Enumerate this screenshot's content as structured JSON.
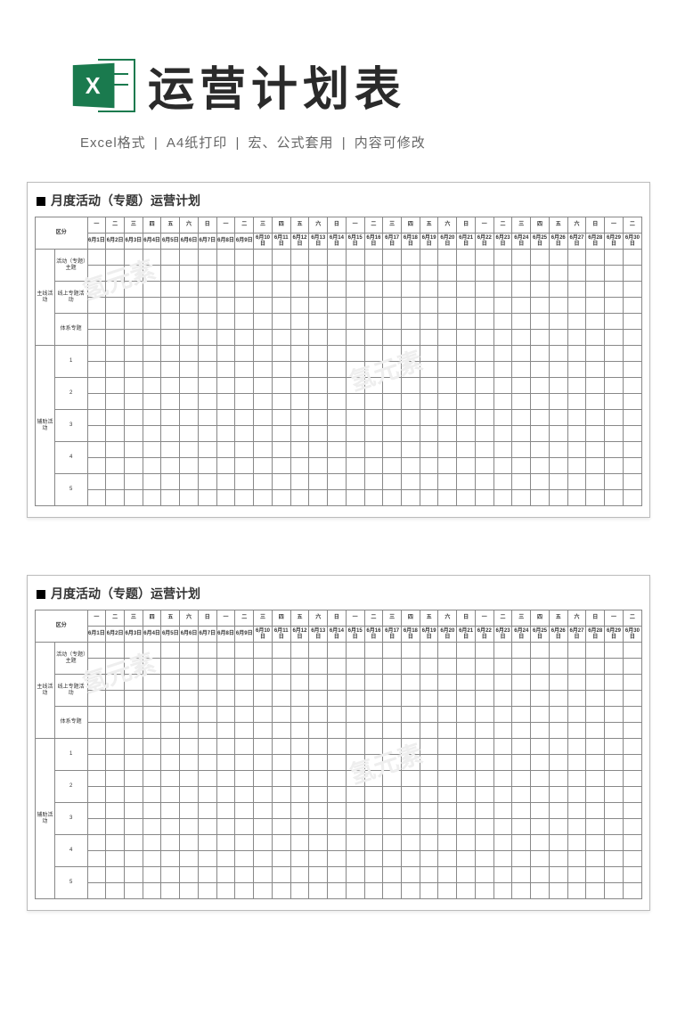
{
  "header": {
    "excel_letter": "X",
    "title": "运营计划表",
    "subtitle_parts": [
      "Excel格式",
      "A4纸打印",
      "宏、公式套用",
      "内容可修改"
    ],
    "separator": " | "
  },
  "watermark": "氢元素",
  "plan": {
    "title_label": "月度活动（专题）运营计划",
    "corner_label": "区分",
    "weekday_cycle": [
      "一",
      "二",
      "三",
      "四",
      "五",
      "六",
      "日"
    ],
    "date_prefix": "6月",
    "date_suffix": "日",
    "days": 30,
    "sections": [
      {
        "category_label": "主线活动",
        "rows": [
          {
            "label": "活动（专题）主题",
            "fill": "yellow",
            "blue_row": true
          },
          {
            "label": "线上专题活动",
            "fill": "yellow",
            "blue_row": false
          },
          {
            "label": "体系专题",
            "fill": "yellow",
            "blue_row": false
          }
        ]
      },
      {
        "category_label": "辅助活动",
        "rows": [
          {
            "label": "1",
            "fill": "green",
            "blue_row": false
          },
          {
            "label": "2",
            "fill": "green",
            "blue_row": false
          },
          {
            "label": "3",
            "fill": "green",
            "blue_row": false
          },
          {
            "label": "4",
            "fill": "green",
            "blue_row": false
          },
          {
            "label": "5",
            "fill": "green",
            "blue_row": false
          }
        ]
      }
    ]
  }
}
